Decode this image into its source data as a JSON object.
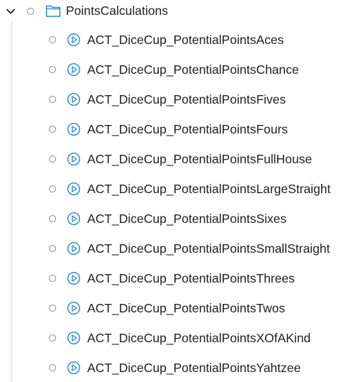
{
  "folder": {
    "label": "PointsCalculations",
    "expanded": true,
    "icon": "folder-icon"
  },
  "children": [
    {
      "label": "ACT_DiceCup_PotentialPointsAces",
      "icon": "action-play-icon"
    },
    {
      "label": "ACT_DiceCup_PotentialPointsChance",
      "icon": "action-play-icon"
    },
    {
      "label": "ACT_DiceCup_PotentialPointsFives",
      "icon": "action-play-icon"
    },
    {
      "label": "ACT_DiceCup_PotentialPointsFours",
      "icon": "action-play-icon"
    },
    {
      "label": "ACT_DiceCup_PotentialPointsFullHouse",
      "icon": "action-play-icon"
    },
    {
      "label": "ACT_DiceCup_PotentialPointsLargeStraight",
      "icon": "action-play-icon"
    },
    {
      "label": "ACT_DiceCup_PotentialPointsSixes",
      "icon": "action-play-icon"
    },
    {
      "label": "ACT_DiceCup_PotentialPointsSmallStraight",
      "icon": "action-play-icon"
    },
    {
      "label": "ACT_DiceCup_PotentialPointsThrees",
      "icon": "action-play-icon"
    },
    {
      "label": "ACT_DiceCup_PotentialPointsTwos",
      "icon": "action-play-icon"
    },
    {
      "label": "ACT_DiceCup_PotentialPointsXOfAKind",
      "icon": "action-play-icon"
    },
    {
      "label": "ACT_DiceCup_PotentialPointsYahtzee",
      "icon": "action-play-icon"
    }
  ],
  "colors": {
    "icon_blue": "#1e88d6",
    "status_gray": "#8a8a8a",
    "guide_line": "#d6d6d6",
    "text": "#1f1f1f"
  }
}
